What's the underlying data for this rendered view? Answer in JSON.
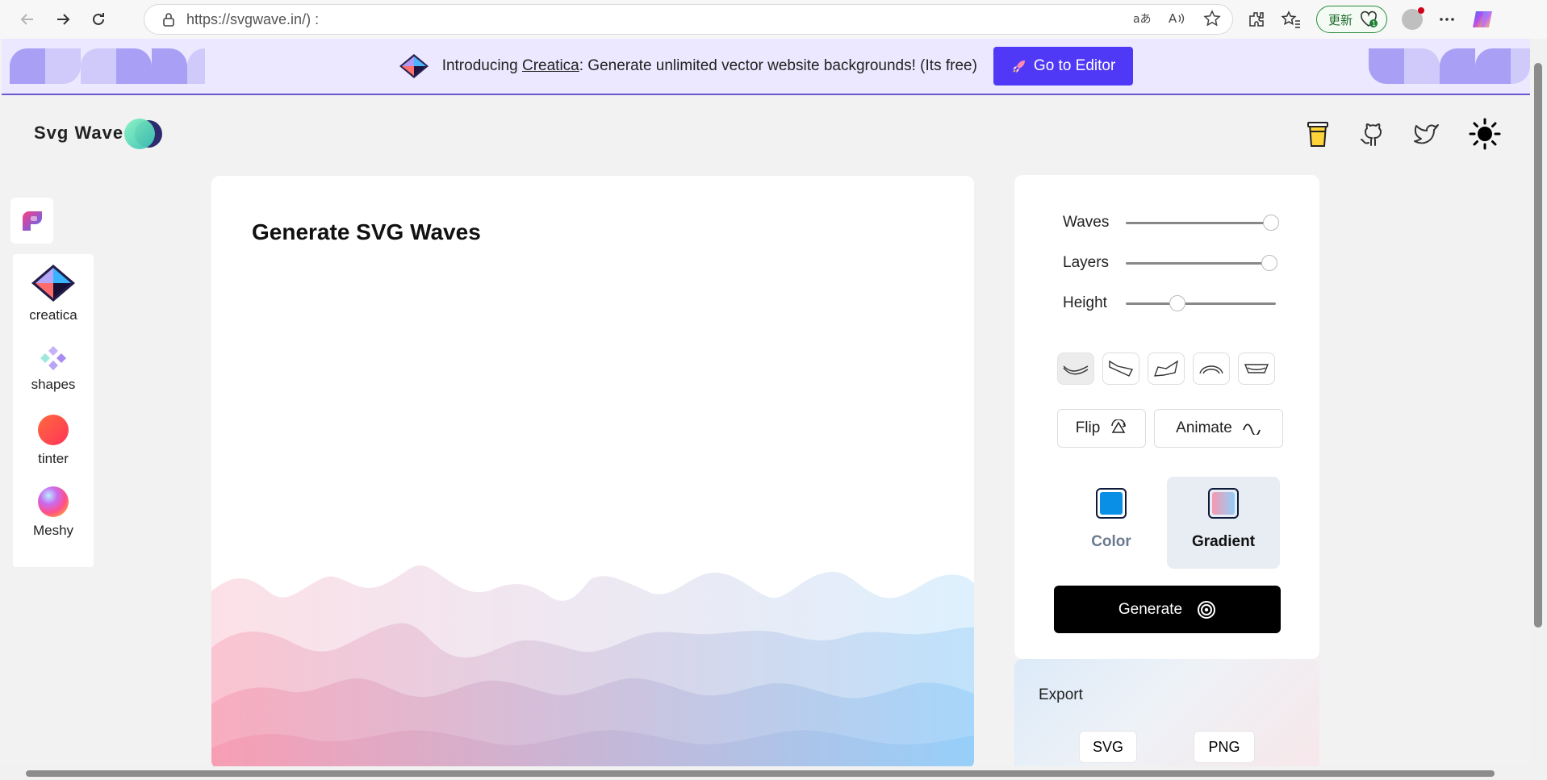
{
  "browser": {
    "url": "https://svgwave.in/​​​)  :",
    "update_label": "更新",
    "icons": [
      "back-icon",
      "forward-icon",
      "refresh-icon",
      "lock-icon",
      "translate-icon",
      "read-aloud-icon",
      "favorite-star-icon",
      "extensions-icon",
      "favorites-icon",
      "profile-avatar",
      "more-icon",
      "copilot-icon"
    ]
  },
  "banner": {
    "text_prefix": "Introducing ",
    "link": "Creatica",
    "text_suffix": ": Generate unlimited vector website backgrounds! (Its free)",
    "button_label": "Go to Editor"
  },
  "header": {
    "brand": "Svg Wave"
  },
  "rail": {
    "items": [
      {
        "label": "creatica",
        "icon": "creatica-cube-icon"
      },
      {
        "label": "shapes",
        "icon": "shapes-icon"
      },
      {
        "label": "tinter",
        "icon": "tinter-icon"
      },
      {
        "label": "Meshy",
        "icon": "meshy-icon"
      }
    ]
  },
  "canvas": {
    "title": "Generate SVG Waves"
  },
  "controls": {
    "waves_label": "Waves",
    "waves_value": 1.0,
    "layers_label": "Layers",
    "layers_value": 1.0,
    "height_label": "Height",
    "height_value": 0.34,
    "flip_label": "Flip",
    "animate_label": "Animate",
    "color_label": "Color",
    "gradient_label": "Gradient",
    "generate_label": "Generate",
    "solid_color": "#0a8fe6",
    "gradient_colors": [
      "#f799b0",
      "#91cdf9"
    ]
  },
  "export": {
    "title": "Export",
    "svg_label": "SVG",
    "png_label": "PNG"
  }
}
